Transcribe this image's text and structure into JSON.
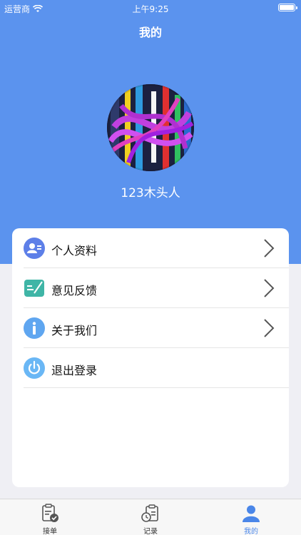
{
  "status_bar": {
    "carrier": "运营商",
    "time": "上午9:25"
  },
  "header": {
    "title": "我的"
  },
  "profile": {
    "username": "123木头人"
  },
  "menu": [
    {
      "label": "个人资料",
      "icon": "person-card-icon",
      "color": "#5d7fe8"
    },
    {
      "label": "意见反馈",
      "icon": "feedback-edit-icon",
      "color": "#3fb5a6"
    },
    {
      "label": "关于我们",
      "icon": "info-icon",
      "color": "#5fa6f0"
    },
    {
      "label": "退出登录",
      "icon": "power-icon",
      "color": "#6ab7f5"
    }
  ],
  "tabs": [
    {
      "label": "接单",
      "icon": "clipboard-check-icon"
    },
    {
      "label": "记录",
      "icon": "clipboard-clock-icon"
    },
    {
      "label": "我的",
      "icon": "person-icon",
      "active": true
    }
  ],
  "colors": {
    "header_bg": "#5b93ee",
    "page_bg": "#efeff4",
    "tab_active": "#4a86e8"
  }
}
